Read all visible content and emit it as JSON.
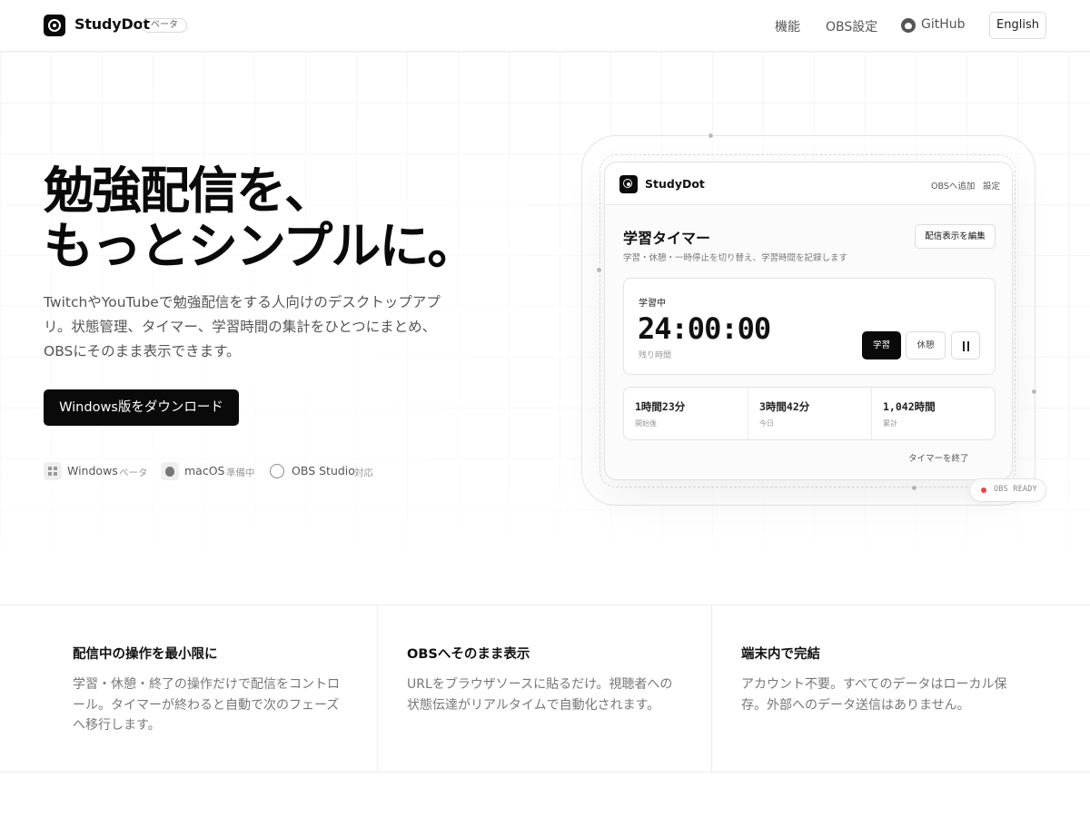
{
  "header": {
    "brand": "StudyDot",
    "beta_badge": "ベータ",
    "nav": [
      "機能",
      "OBS設定",
      "GitHub"
    ],
    "language_button": "English"
  },
  "hero": {
    "title_lines": [
      "勉強配信を、",
      "もっとシンプルに。"
    ],
    "description": "TwitchやYouTubeで勉強配信をする人向けのデスクトップアプリ。状態管理、タイマー、学習時間の集計をひとつにまとめ、OBSにそのまま表示できます。",
    "download_button": "Windows版をダウンロード",
    "platforms": [
      {
        "name": "Windows",
        "status": "ベータ",
        "icon": "windows-icon"
      },
      {
        "name": "macOS",
        "status": "準備中",
        "icon": "apple-icon"
      },
      {
        "name": "OBS Studio",
        "status": "対応",
        "icon": "obs-icon"
      }
    ]
  },
  "app_preview": {
    "brand": "StudyDot",
    "header_links": [
      "OBSへ追加",
      "設定"
    ],
    "title": "学習タイマー",
    "subtitle": "学習・休憩・一時停止を切り替え、学習時間を記録します",
    "edit_button": "配信表示を編集",
    "timer": {
      "state_label": "学習中",
      "value": "24:00:00",
      "remaining_label": "残り時間",
      "study_button": "学習",
      "break_button": "休憩"
    },
    "stats": [
      {
        "value": "1時間23分",
        "label": "開始後"
      },
      {
        "value": "3時間42分",
        "label": "今日"
      },
      {
        "value": "1,042時間",
        "label": "累計"
      }
    ],
    "end_link": "タイマーを終了",
    "obs_status": "OBS READY",
    "colors": {
      "status_dot": "#ef4444",
      "primary": "#0a0a0a"
    }
  },
  "features": [
    {
      "title": "配信中の操作を最小限に",
      "description": "学習・休憩・終了の操作だけで配信をコントロール。タイマーが終わると自動で次のフェーズへ移行します。"
    },
    {
      "title": "OBSへそのまま表示",
      "description": "URLをブラウザソースに貼るだけ。視聴者への状態伝達がリアルタイムで自動化されます。"
    },
    {
      "title": "端末内で完結",
      "description": "アカウント不要。すべてのデータはローカル保存。外部へのデータ送信はありません。"
    }
  ]
}
